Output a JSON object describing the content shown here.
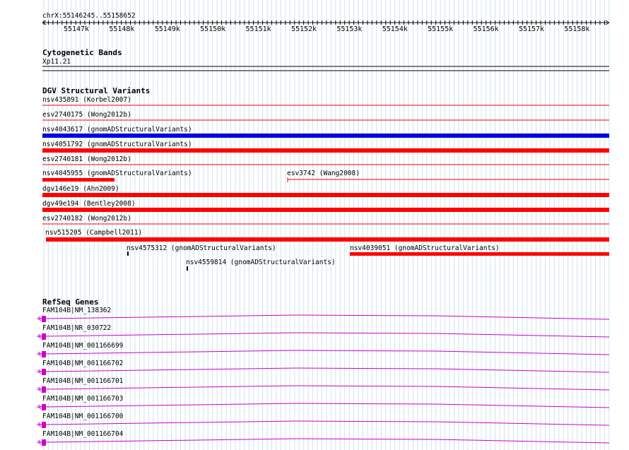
{
  "ruler": {
    "region": "chrX:55146245..55158652",
    "ticks": [
      "55147k",
      "55148k",
      "55149k",
      "55150k",
      "55151k",
      "55152k",
      "55153k",
      "55154k",
      "55155k",
      "55156k",
      "55157k",
      "55158k"
    ]
  },
  "cytobands": {
    "title": "Cytogenetic Bands",
    "band": "Xp11.21"
  },
  "dgv": {
    "title": "DGV Structural Variants",
    "variants": [
      {
        "label": "nsv435891 (Korbel2007)",
        "color": "#ff0000",
        "style": "line"
      },
      {
        "label": "esv2740175 (Wong2012b)",
        "color": "#ff0000",
        "style": "line"
      },
      {
        "label": "nsv4043617 (gnomADStructuralVariants)",
        "color": "#0000dd",
        "style": "bar"
      },
      {
        "label": "nsv4051792 (gnomADStructuralVariants)",
        "color": "#ff0000",
        "style": "bar"
      },
      {
        "label": "esv2740181 (Wong2012b)",
        "color": "#ff0000",
        "style": "line"
      },
      {
        "label": "nsv4045955 (gnomADStructuralVariants)",
        "color": "#ff0000",
        "style": "bar-partial"
      },
      {
        "label": "esv3742 (Wang2008)",
        "color": "#ff0000",
        "style": "line"
      },
      {
        "label": "dgv146e19 (Ahn2009)",
        "color": "#ff0000",
        "style": "bar"
      },
      {
        "label": "dgv49e194 (Bentley2008)",
        "color": "#ff0000",
        "style": "bar"
      },
      {
        "label": "esv2740182 (Wong2012b)",
        "color": "#ff0000",
        "style": "line"
      },
      {
        "label": "nsv515205 (Campbell2011)",
        "color": "#ff0000",
        "style": "bar"
      },
      {
        "label": "nsv4575312 (gnomADStructuralVariants)",
        "color": "#000000",
        "style": "tick"
      },
      {
        "label": "nsv4039051 (gnomADStructuralVariants)",
        "color": "#ff0000",
        "style": "bar"
      },
      {
        "label": "nsv4559814 (gnomADStructuralVariants)",
        "color": "#000000",
        "style": "tick"
      }
    ]
  },
  "refseq": {
    "title": "RefSeq Genes",
    "color": "#cc00cc",
    "genes": [
      "FAM104B|NM_138362",
      "FAM104B|NR_030722",
      "FAM104B|NM_001166699",
      "FAM104B|NM_001166702",
      "FAM104B|NM_001166701",
      "FAM104B|NM_001166703",
      "FAM104B|NM_001166700",
      "FAM104B|NM_001166704"
    ]
  }
}
